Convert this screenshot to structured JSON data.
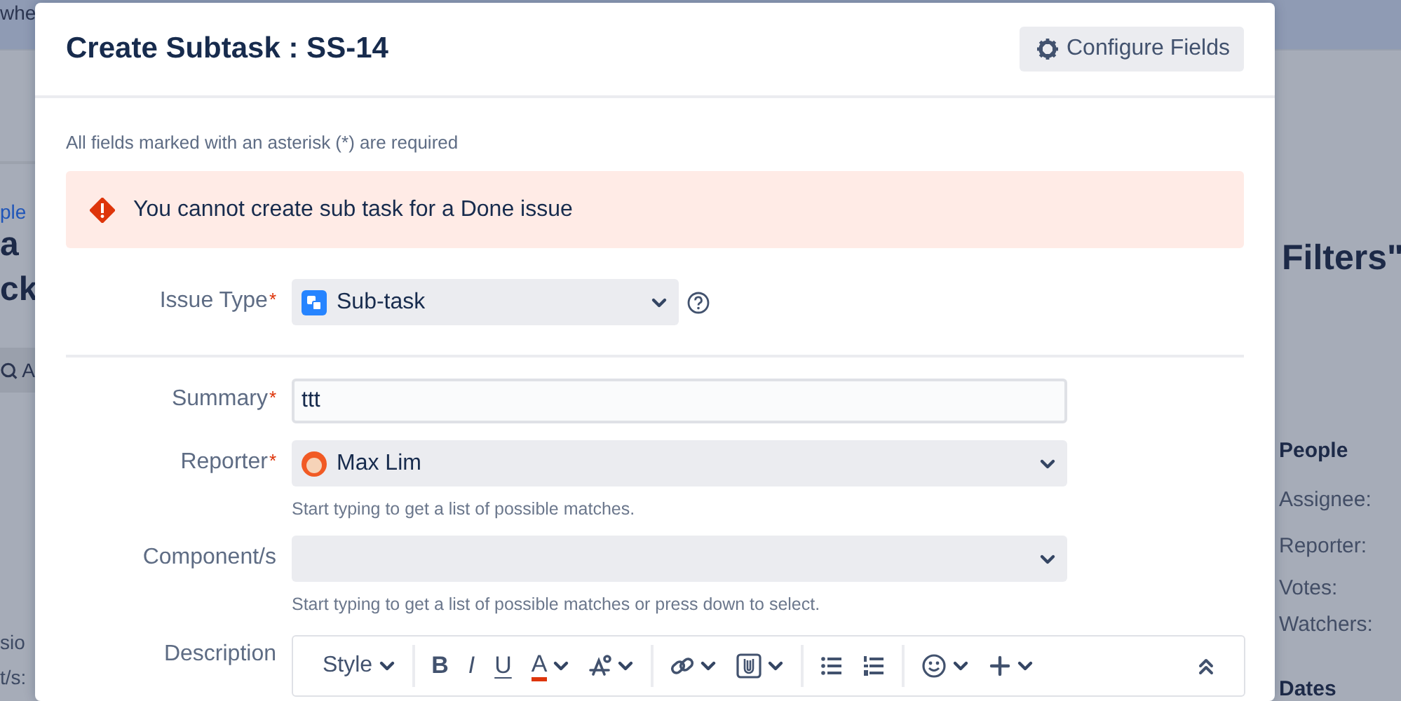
{
  "background_page": {
    "top_text": "whe",
    "breadcrumb": "ple",
    "title_lines": [
      "a",
      "ck"
    ],
    "action_button": "A",
    "left_labels": [
      "sio",
      "t/s:"
    ],
    "title_right": "Filters\"",
    "people_heading": "People",
    "people_labels": [
      "Assignee:",
      "Reporter:",
      "Votes:",
      "Watchers:"
    ],
    "dates_heading": "Dates"
  },
  "dialog": {
    "title": "Create Subtask : SS-14",
    "configure_button": "Configure Fields",
    "required_note": "All fields marked with an asterisk (*) are required",
    "error": "You cannot create sub task for a Done issue",
    "fields": [
      {
        "kind": "issue_type_select",
        "label": "Issue Type",
        "required_mark": "*",
        "value": "Sub-task",
        "help": true
      },
      {
        "kind": "divider"
      },
      {
        "kind": "text",
        "label": "Summary",
        "required_mark": "*",
        "value": "ttt"
      },
      {
        "kind": "user_select",
        "label": "Reporter",
        "required_mark": "*",
        "value": "Max Lim",
        "hint": "Start typing to get a list of possible matches."
      },
      {
        "kind": "select",
        "label": "Component/s",
        "hint": "Start typing to get a list of possible matches or press down to select."
      },
      {
        "kind": "editor",
        "label": "Description",
        "toolbar": [
          {
            "kind": "style",
            "label": "Style",
            "dropdown": true
          },
          {
            "kind": "separator"
          },
          {
            "kind": "bold",
            "label": "B"
          },
          {
            "kind": "italic",
            "label": "I"
          },
          {
            "kind": "underline",
            "label": "U"
          },
          {
            "kind": "color",
            "label": "A",
            "dropdown": true
          },
          {
            "kind": "format",
            "dropdown": true
          },
          {
            "kind": "separator"
          },
          {
            "kind": "link",
            "dropdown": true
          },
          {
            "kind": "attach",
            "dropdown": true
          },
          {
            "kind": "separator"
          },
          {
            "kind": "bullets"
          },
          {
            "kind": "numbers"
          },
          {
            "kind": "separator"
          },
          {
            "kind": "emoji",
            "dropdown": true
          },
          {
            "kind": "insert",
            "dropdown": true
          },
          {
            "kind": "collapse"
          }
        ]
      }
    ]
  }
}
